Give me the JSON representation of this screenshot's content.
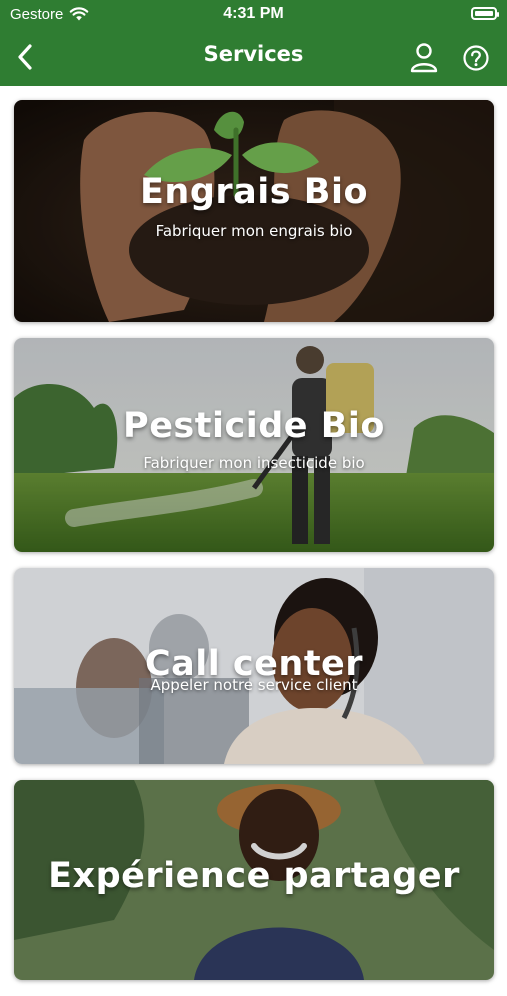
{
  "status_bar": {
    "carrier": "Gestore",
    "time": "4:31 PM"
  },
  "header": {
    "title": "Services",
    "icons": [
      "back-chevron",
      "user-icon",
      "help-icon"
    ]
  },
  "services": [
    {
      "title": "Engrais Bio",
      "subtitle": "Fabriquer mon engrais bio"
    },
    {
      "title": "Pesticide Bio",
      "subtitle": "Fabriquer mon insecticide bio"
    },
    {
      "title": "Call center",
      "subtitle": "Appeler notre service client"
    },
    {
      "title": "Expérience partager"
    }
  ],
  "colors": {
    "primary": "#2f7d32",
    "text_on_primary": "#ffffff"
  }
}
